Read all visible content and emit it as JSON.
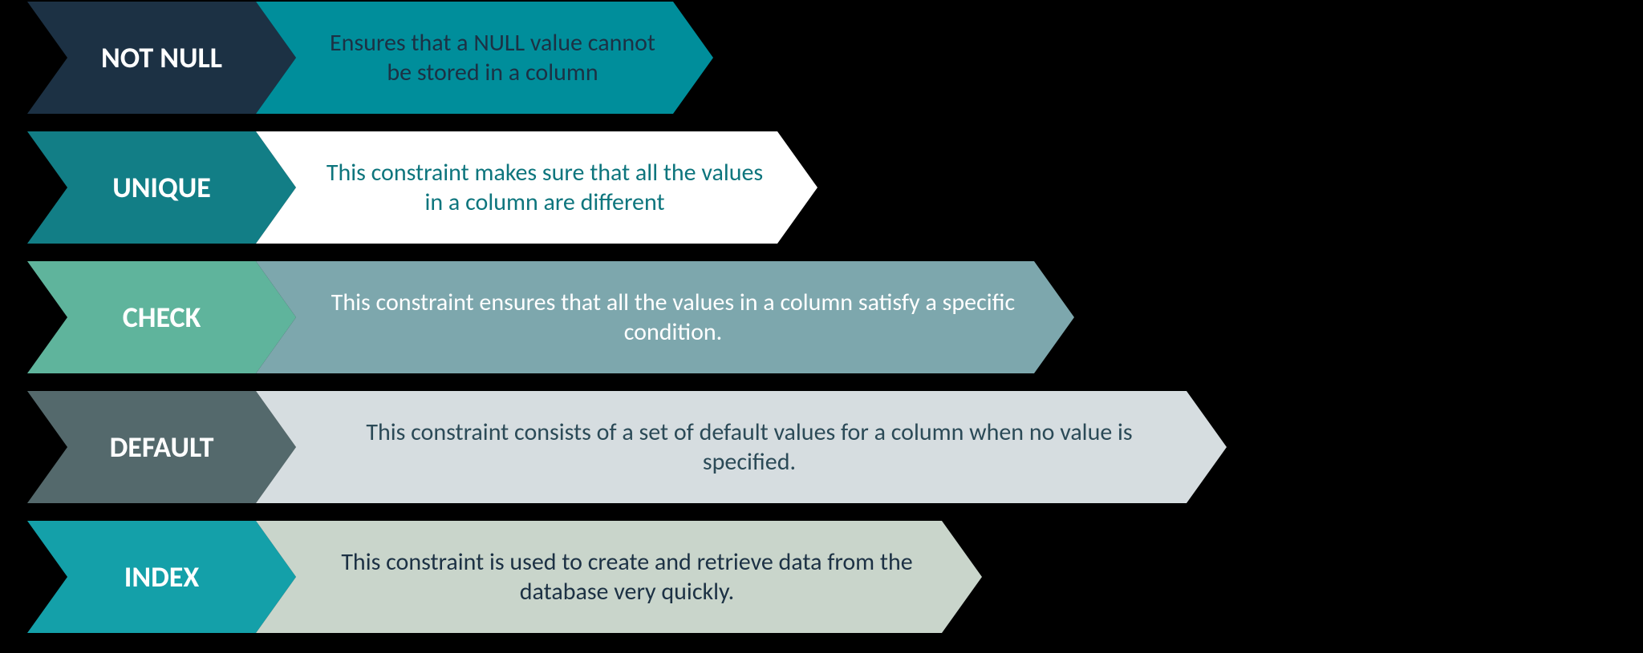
{
  "rows": [
    {
      "label": "NOT NULL",
      "desc": "Ensures that a NULL value cannot be stored in a column",
      "labelColor": "#1c3144",
      "descBg": "#008e9b",
      "descText": "#1c3144"
    },
    {
      "label": "UNIQUE",
      "desc": "This constraint makes sure that all the values in a column are different",
      "labelColor": "#127e86",
      "descBg": "#ffffff",
      "descText": "#0d757d"
    },
    {
      "label": "CHECK",
      "desc": "This constraint ensures that all the values in a column satisfy a specific condition.",
      "labelColor": "#5fb49c",
      "descBg": "#7da7ad",
      "descText": "#ffffff"
    },
    {
      "label": "DEFAULT",
      "desc": "This constraint consists of a set of default values for a column when no value is specified.",
      "labelColor": "#54696c",
      "descBg": "#d6dde0",
      "descText": "#2b4a57"
    },
    {
      "label": "INDEX",
      "desc": "This constraint is used to create and retrieve data from the database very quickly.",
      "labelColor": "#14a0a9",
      "descBg": "#c9d5cb",
      "descText": "#1c3144"
    }
  ]
}
